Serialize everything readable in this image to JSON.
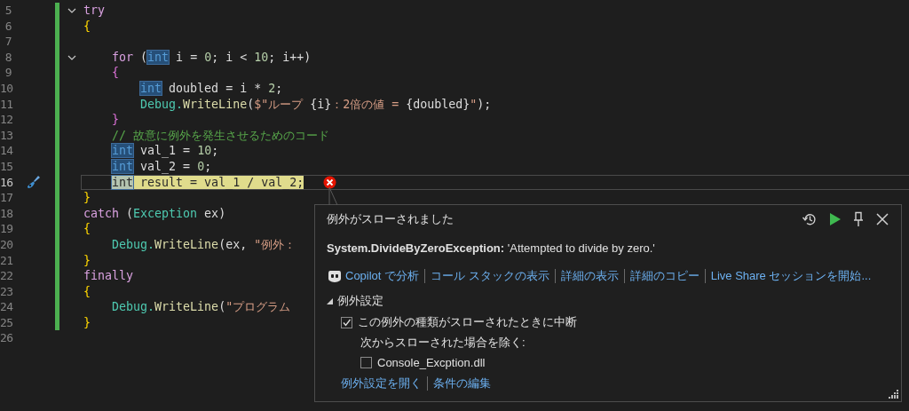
{
  "editor": {
    "lines": [
      {
        "number": "5",
        "changed": true,
        "foldable": true,
        "current": false,
        "marker": false,
        "tokens": [
          {
            "kind": "control",
            "text": "try",
            "highlighted": false
          }
        ]
      },
      {
        "number": "6",
        "changed": true,
        "foldable": false,
        "current": false,
        "marker": false,
        "tokens": [
          {
            "kind": "brace",
            "text": "{",
            "highlighted": false
          }
        ]
      },
      {
        "number": "7",
        "changed": true,
        "foldable": false,
        "current": false,
        "marker": false
      },
      {
        "number": "8",
        "changed": true,
        "foldable": true,
        "current": false,
        "marker": false,
        "tokens": [
          {
            "kind": "control",
            "text": "    for",
            "highlighted": false
          },
          {
            "kind": "plain",
            "text": " (",
            "highlighted": false
          },
          {
            "kind": "keyword",
            "text": "int",
            "highlighted": true
          },
          {
            "kind": "plain",
            "text": " i = ",
            "highlighted": false
          },
          {
            "kind": "number",
            "text": "0",
            "highlighted": false
          },
          {
            "kind": "plain",
            "text": "; i < ",
            "highlighted": false
          },
          {
            "kind": "number",
            "text": "10",
            "highlighted": false
          },
          {
            "kind": "plain",
            "text": "; i++)",
            "highlighted": false
          }
        ]
      },
      {
        "number": "9",
        "changed": true,
        "foldable": false,
        "current": false,
        "marker": false,
        "tokens": [
          {
            "kind": "brace2",
            "text": "    {",
            "highlighted": false
          }
        ]
      },
      {
        "number": "10",
        "changed": true,
        "foldable": false,
        "current": false,
        "marker": false,
        "tokens": [
          {
            "kind": "keyword",
            "text": "        int",
            "highlighted": true
          },
          {
            "kind": "plain",
            "text": " doubled = i * ",
            "highlighted": false
          },
          {
            "kind": "number",
            "text": "2",
            "highlighted": false
          },
          {
            "kind": "plain",
            "text": ";",
            "highlighted": false
          }
        ]
      },
      {
        "number": "11",
        "changed": true,
        "foldable": false,
        "current": false,
        "marker": false,
        "tokens": [
          {
            "kind": "class",
            "text": "        Debug.",
            "highlighted": false
          },
          {
            "kind": "method",
            "text": "WriteLine",
            "highlighted": false
          },
          {
            "kind": "plain",
            "text": "(",
            "highlighted": false
          },
          {
            "kind": "string",
            "text": "$\"ループ ",
            "highlighted": false
          },
          {
            "kind": "plain",
            "text": "{i}",
            "highlighted": false
          },
          {
            "kind": "string",
            "text": "：2倍の値 = ",
            "highlighted": false
          },
          {
            "kind": "plain",
            "text": "{doubled}",
            "highlighted": false
          },
          {
            "kind": "string",
            "text": "\"",
            "highlighted": false
          },
          {
            "kind": "plain",
            "text": ");",
            "highlighted": false
          }
        ]
      },
      {
        "number": "12",
        "changed": true,
        "foldable": false,
        "current": false,
        "marker": false,
        "tokens": [
          {
            "kind": "brace2",
            "text": "    }",
            "highlighted": false
          }
        ]
      },
      {
        "number": "13",
        "changed": true,
        "foldable": false,
        "current": false,
        "marker": false,
        "tokens": [
          {
            "kind": "comment",
            "text": "    // 故意に例外を発生させるためのコード",
            "highlighted": false
          }
        ]
      },
      {
        "number": "14",
        "changed": true,
        "foldable": false,
        "current": false,
        "marker": false,
        "tokens": [
          {
            "kind": "keyword",
            "text": "    int",
            "highlighted": true
          },
          {
            "kind": "plain",
            "text": " val_1 = ",
            "highlighted": false
          },
          {
            "kind": "number",
            "text": "10",
            "highlighted": false
          },
          {
            "kind": "plain",
            "text": ";",
            "highlighted": false
          }
        ]
      },
      {
        "number": "15",
        "changed": true,
        "foldable": false,
        "current": false,
        "marker": false,
        "tokens": [
          {
            "kind": "keyword",
            "text": "    int",
            "highlighted": true
          },
          {
            "kind": "plain",
            "text": " val_2 = ",
            "highlighted": false
          },
          {
            "kind": "number",
            "text": "0",
            "highlighted": false
          },
          {
            "kind": "plain",
            "text": ";",
            "highlighted": false
          }
        ]
      },
      {
        "number": "16",
        "changed": true,
        "foldable": false,
        "current": true,
        "marker": true,
        "tokens": [
          {
            "kind": "keyword",
            "text": "    int",
            "highlighted": true
          },
          {
            "kind": "plain",
            "text": " result = val_1 / val_2;",
            "highlighted": false
          }
        ]
      },
      {
        "number": "17",
        "changed": true,
        "foldable": false,
        "current": false,
        "marker": false,
        "tokens": [
          {
            "kind": "brace",
            "text": "}",
            "highlighted": false
          }
        ]
      },
      {
        "number": "18",
        "changed": true,
        "foldable": false,
        "current": false,
        "marker": false,
        "tokens": [
          {
            "kind": "control",
            "text": "catch",
            "highlighted": false
          },
          {
            "kind": "plain",
            "text": " (",
            "highlighted": false
          },
          {
            "kind": "class",
            "text": "Exception",
            "highlighted": false
          },
          {
            "kind": "plain",
            "text": " ex)",
            "highlighted": false
          }
        ]
      },
      {
        "number": "19",
        "changed": true,
        "foldable": false,
        "current": false,
        "marker": false,
        "tokens": [
          {
            "kind": "brace",
            "text": "{",
            "highlighted": false
          }
        ]
      },
      {
        "number": "20",
        "changed": true,
        "foldable": false,
        "current": false,
        "marker": false,
        "tokens": [
          {
            "kind": "class",
            "text": "    Debug.",
            "highlighted": false
          },
          {
            "kind": "method",
            "text": "WriteLine",
            "highlighted": false
          },
          {
            "kind": "plain",
            "text": "(ex, ",
            "highlighted": false
          },
          {
            "kind": "string",
            "text": "\"例外：",
            "highlighted": false
          }
        ]
      },
      {
        "number": "21",
        "changed": true,
        "foldable": false,
        "current": false,
        "marker": false,
        "tokens": [
          {
            "kind": "brace",
            "text": "}",
            "highlighted": false
          }
        ]
      },
      {
        "number": "22",
        "changed": true,
        "foldable": false,
        "current": false,
        "marker": false,
        "tokens": [
          {
            "kind": "control",
            "text": "finally",
            "highlighted": false
          }
        ]
      },
      {
        "number": "23",
        "changed": true,
        "foldable": false,
        "current": false,
        "marker": false,
        "tokens": [
          {
            "kind": "brace",
            "text": "{",
            "highlighted": false
          }
        ]
      },
      {
        "number": "24",
        "changed": true,
        "foldable": false,
        "current": false,
        "marker": false,
        "tokens": [
          {
            "kind": "class",
            "text": "    Debug.",
            "highlighted": false
          },
          {
            "kind": "method",
            "text": "WriteLine",
            "highlighted": false
          },
          {
            "kind": "plain",
            "text": "(",
            "highlighted": false
          },
          {
            "kind": "string",
            "text": "\"プログラム",
            "highlighted": false
          }
        ]
      },
      {
        "number": "25",
        "changed": true,
        "foldable": false,
        "current": false,
        "marker": false,
        "tokens": [
          {
            "kind": "brace",
            "text": "}",
            "highlighted": false
          }
        ]
      },
      {
        "number": "26",
        "changed": false,
        "foldable": false,
        "current": false,
        "marker": false
      }
    ]
  },
  "exception_popup": {
    "title": "例外がスローされました",
    "actions": [
      {
        "kind": "history"
      },
      {
        "kind": "continue"
      },
      {
        "kind": "pin"
      },
      {
        "kind": "close"
      }
    ],
    "message": "**System.DivideByZeroException:** 'Attempted to divide by zero.'",
    "links": [
      {
        "kind": "copilot",
        "text": "Copilot で分析"
      },
      {
        "kind": "plain",
        "text": "コール スタックの表示"
      },
      {
        "kind": "plain",
        "text": "詳細の表示"
      },
      {
        "kind": "plain",
        "text": "詳細のコピー"
      },
      {
        "kind": "plain",
        "text": "Live Share セッションを開始..."
      }
    ],
    "settings": {
      "label": "例外設定",
      "expanded": true,
      "break_option": {
        "label": "この例外の種類がスローされたときに中断",
        "checked": true
      },
      "exclude_label": "次からスローされた場合を除く:",
      "modules": [
        {
          "label": "Console_Excption.dll",
          "checked": false
        }
      ]
    },
    "footer_links": [
      "例外設定を開く",
      "条件の編集"
    ]
  }
}
